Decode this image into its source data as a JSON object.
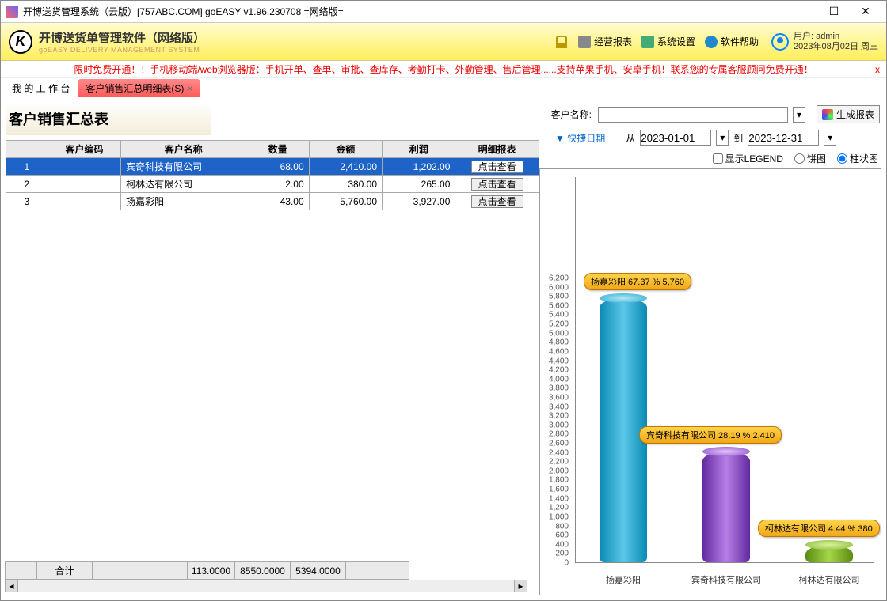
{
  "window": {
    "title": "开博送货管理系统（云版）[757ABC.COM]   goEASY v1.96.230708   =网络版="
  },
  "header": {
    "brand_cn": "开博送货单管理软件（网络版）",
    "brand_en": "goEASY DELIVERY MANAGEMENT SYSTEM",
    "menu_report": "经营报表",
    "menu_settings": "系统设置",
    "menu_help": "软件帮助",
    "user_line1": "用户: admin",
    "user_line2": "2023年08月02日 周三"
  },
  "notice": {
    "text": "限时免费开通！！手机移动端/web浏览器版：手机开单、查单、审批、查库存、考勤打卡、外勤管理、售后管理......支持苹果手机、安卓手机！联系您的专属客服顾问免费开通！",
    "close": "x"
  },
  "tabs": {
    "t1": "我 的 工 作 台",
    "t2": "客户销售汇总明细表(S)"
  },
  "page": {
    "title": "客户销售汇总表"
  },
  "filter": {
    "name_label": "客户名称:",
    "quick_label": "快捷日期",
    "from_label": "从",
    "to_label": "到",
    "date_from": "2023-01-01",
    "date_to": "2023-12-31",
    "gen_btn": "生成报表"
  },
  "table": {
    "h_code": "客户编码",
    "h_name": "客户名称",
    "h_qty": "数量",
    "h_amt": "金额",
    "h_profit": "利润",
    "h_detail": "明细报表",
    "rows": [
      {
        "idx": "1",
        "code": "",
        "name": "宾奇科技有限公司",
        "qty": "68.00",
        "amt": "2,410.00",
        "profit": "1,202.00",
        "btn": "点击查看"
      },
      {
        "idx": "2",
        "code": "",
        "name": "柯林达有限公司",
        "qty": "2.00",
        "amt": "380.00",
        "profit": "265.00",
        "btn": "点击查看"
      },
      {
        "idx": "3",
        "code": "",
        "name": "扬嘉彩阳",
        "qty": "43.00",
        "amt": "5,760.00",
        "profit": "3,927.00",
        "btn": "点击查看"
      }
    ],
    "total_label": "合计",
    "total_qty": "113.0000",
    "total_amt": "8550.0000",
    "total_profit": "5394.0000"
  },
  "chartctl": {
    "legend": "显示LEGEND",
    "pie": "饼图",
    "bar": "柱状图"
  },
  "chart_data": {
    "type": "bar",
    "title": "",
    "xlabel": "",
    "ylabel": "",
    "ylim": [
      0,
      6200
    ],
    "ytick_step": 200,
    "categories": [
      "扬嘉彩阳",
      "宾奇科技有限公司",
      "柯林达有限公司"
    ],
    "values": [
      5760,
      2410,
      380
    ],
    "percents": [
      67.37,
      28.19,
      4.44
    ],
    "bubbles": [
      "扬嘉彩阳 67.37 % 5,760",
      "宾奇科技有限公司 28.19 % 2,410",
      "柯林达有限公司 4.44 % 380"
    ]
  }
}
